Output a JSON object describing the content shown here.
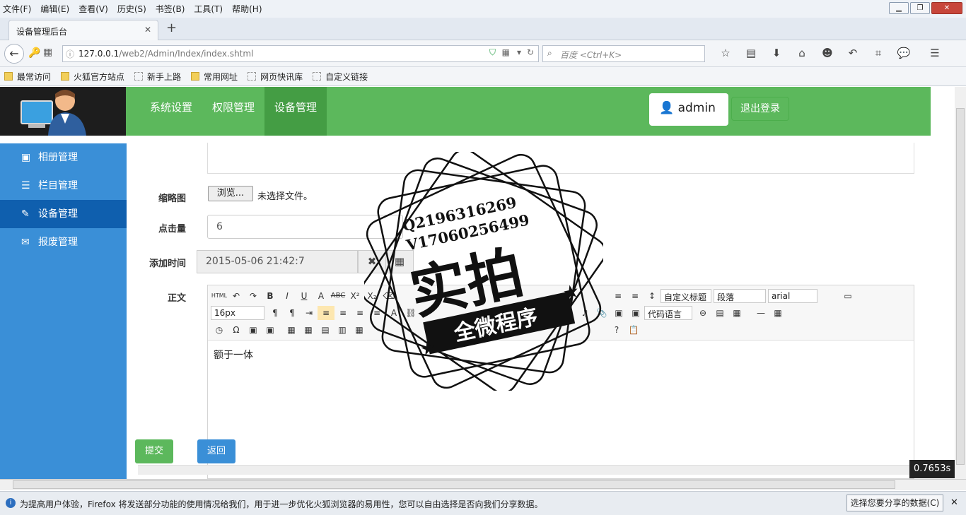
{
  "menubar": {
    "items": [
      "文件(F)",
      "编辑(E)",
      "查看(V)",
      "历史(S)",
      "书签(B)",
      "工具(T)",
      "帮助(H)"
    ]
  },
  "tab": {
    "title": "设备管理后台"
  },
  "url": {
    "host": "127.0.0.1",
    "path": "/web2/Admin/Index/index.shtml"
  },
  "search": {
    "placeholder": "百度 <Ctrl+K>"
  },
  "bookmarks": [
    "最常访问",
    "火狐官方站点",
    "新手上路",
    "常用网址",
    "网页快讯库",
    "自定义链接"
  ],
  "nav": {
    "items": [
      "系统设置",
      "权限管理",
      "设备管理"
    ],
    "active": 2,
    "user": "admin",
    "logout": "退出登录"
  },
  "sidebar": {
    "items": [
      {
        "label": "相册管理",
        "icon": "image-icon"
      },
      {
        "label": "栏目管理",
        "icon": "list-icon"
      },
      {
        "label": "设备管理",
        "icon": "edit-icon"
      },
      {
        "label": "报废管理",
        "icon": "mail-icon"
      }
    ],
    "active": 2
  },
  "form": {
    "thumb_label": "缩略图",
    "browse": "浏览...",
    "no_file": "未选择文件。",
    "clicks_label": "点击量",
    "clicks_value": "6",
    "time_label": "添加时间",
    "time_value": "2015-05-06 21:42:7",
    "body_label": "正文",
    "body_text": "额于一体"
  },
  "editor": {
    "title_select": "自定义标题",
    "para_select": "段落",
    "font_select": "arial",
    "size_select": "16px",
    "code_select": "代码语言"
  },
  "buttons": {
    "submit": "提交",
    "back": "返回"
  },
  "timer": "0.7653s",
  "watermark": {
    "line1": "Q2196316269",
    "line2": "V17060256499",
    "big": "实拍",
    "ribbon": "全微程序"
  },
  "notification": {
    "text": "为提高用户体验，Firefox 将发送部分功能的使用情况给我们，用于进一步优化火狐浏览器的易用性，您可以自由选择是否向我们分享数据。",
    "button": "选择您要分享的数据(C)"
  }
}
